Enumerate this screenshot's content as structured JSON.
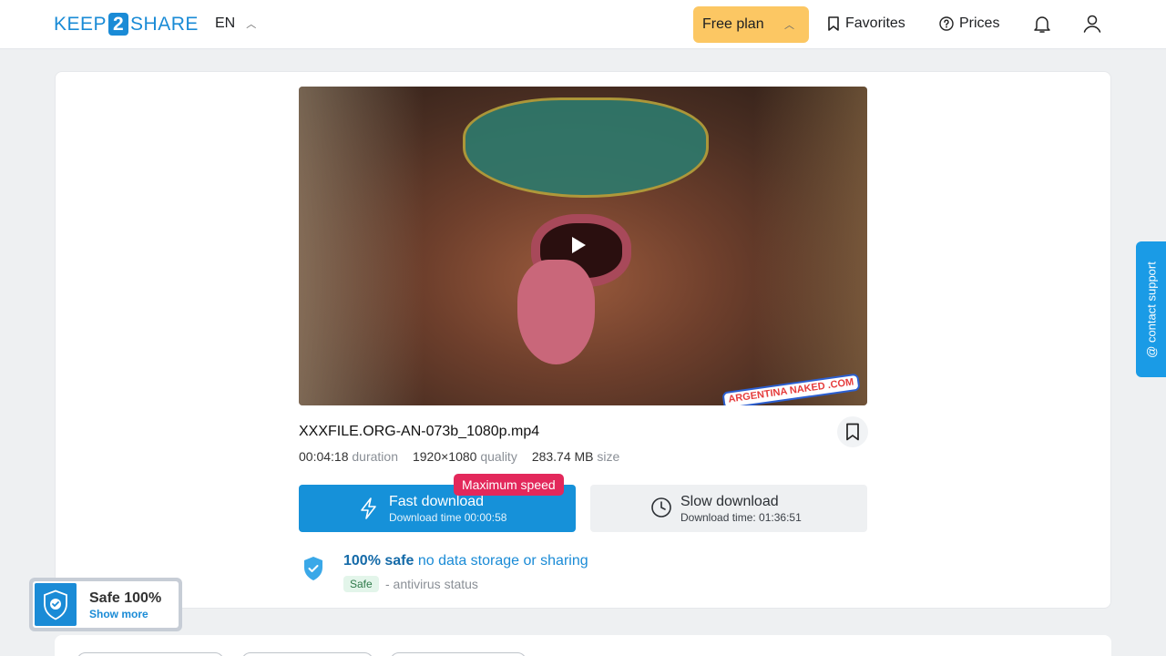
{
  "header": {
    "logo": {
      "pre": "KEEP",
      "num": "2",
      "post": "SHARE"
    },
    "language": "EN",
    "plan_label": "Free plan",
    "favorites_label": "Favorites",
    "prices_label": "Prices"
  },
  "file": {
    "name": "XXXFILE.ORG-AN-073b_1080p.mp4",
    "duration_value": "00:04:18",
    "duration_label": "duration",
    "quality_value": "1920×1080",
    "quality_label": "quality",
    "size_value": "283.74 MB",
    "size_label": "size",
    "watermark": "ARGENTINA NAKED .COM"
  },
  "download": {
    "fast_title": "Fast download",
    "fast_sub": "Download time 00:00:58",
    "fast_badge": "Maximum speed",
    "slow_title": "Slow download",
    "slow_sub": "Download time: 01:36:51"
  },
  "safety": {
    "strong": "100% safe",
    "rest": "no data storage or sharing",
    "tag": "Safe",
    "antivirus": "- antivirus status"
  },
  "support_label": "@ contact support",
  "safe_widget": {
    "title": "Safe 100%",
    "link": "Show more"
  },
  "colors": {
    "accent": "#1691d9",
    "plan": "#fcc763",
    "badge": "#e3285b"
  }
}
